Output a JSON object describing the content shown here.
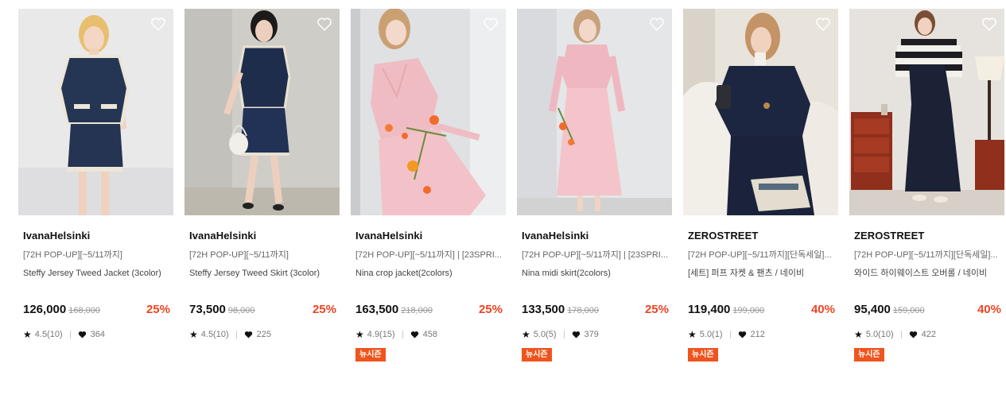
{
  "products": [
    {
      "brand": "IvanaHelsinki",
      "tag": "[72H POP-UP][~5/11까지]",
      "name": "Steffy Jersey Tweed Jacket (3color)",
      "price": "126,000",
      "original_price": "168,000",
      "discount": "25%",
      "rating": "4.5(10)",
      "likes": "364",
      "badge": null
    },
    {
      "brand": "IvanaHelsinki",
      "tag": "[72H POP-UP][~5/11까지]",
      "name": "Steffy Jersey Tweed Skirt (3color)",
      "price": "73,500",
      "original_price": "98,000",
      "discount": "25%",
      "rating": "4.5(10)",
      "likes": "225",
      "badge": null
    },
    {
      "brand": "IvanaHelsinki",
      "tag": "[72H POP-UP][~5/11까지] | [23SPRI...",
      "name": "Nina crop jacket(2colors)",
      "price": "163,500",
      "original_price": "218,000",
      "discount": "25%",
      "rating": "4.9(15)",
      "likes": "458",
      "badge": "뉴시즌"
    },
    {
      "brand": "IvanaHelsinki",
      "tag": "[72H POP-UP][~5/11까지] | [23SPRI...",
      "name": "Nina midi skirt(2colors)",
      "price": "133,500",
      "original_price": "178,000",
      "discount": "25%",
      "rating": "5.0(5)",
      "likes": "379",
      "badge": "뉴시즌"
    },
    {
      "brand": "ZEROSTREET",
      "tag": "[72H POP-UP][~5/11까지][단독세일]...",
      "name": "[세트] 퍼프 자켓 & 팬츠 / 네이비",
      "price": "119,400",
      "original_price": "199,000",
      "discount": "40%",
      "rating": "5.0(1)",
      "likes": "212",
      "badge": "뉴시즌"
    },
    {
      "brand": "ZEROSTREET",
      "tag": "[72H POP-UP][~5/11까지][단독세일]...",
      "name": "와이드 하이웨이스트 오버롤 / 네이비",
      "price": "95,400",
      "original_price": "159,000",
      "discount": "40%",
      "rating": "5.0(10)",
      "likes": "422",
      "badge": "뉴시즌"
    }
  ],
  "colors": {
    "accent": "#ee4423",
    "badge_bg": "#f0541e"
  },
  "icons": {
    "wishlist": "heart-outline-icon",
    "rating": "star-icon",
    "likes": "heart-filled-icon"
  }
}
